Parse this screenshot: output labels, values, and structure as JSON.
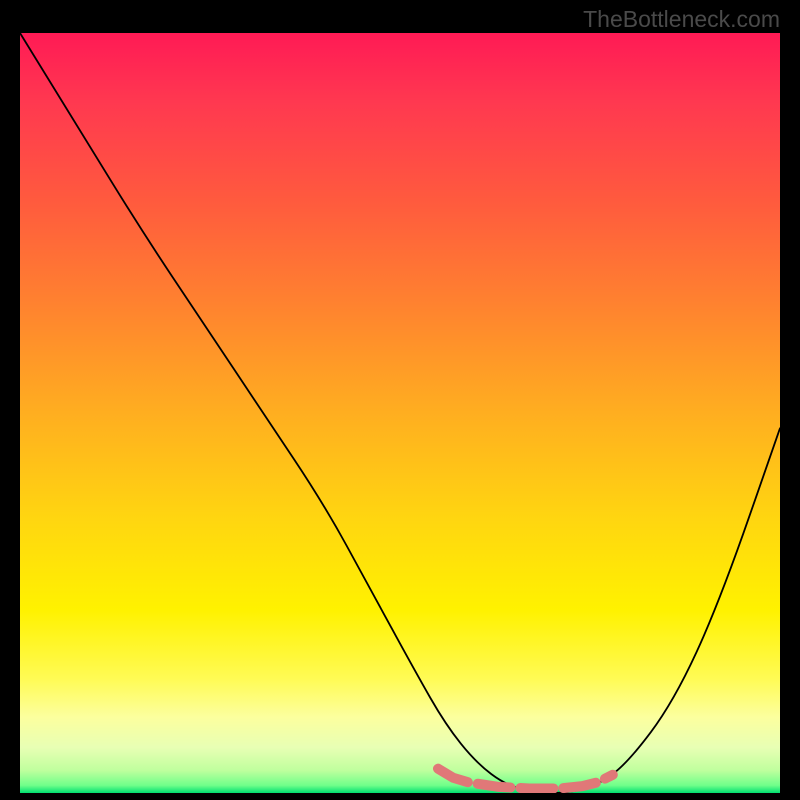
{
  "watermark": "TheBottleneck.com",
  "chart_data": {
    "type": "line",
    "title": "",
    "xlabel": "",
    "ylabel": "",
    "xlim": [
      0,
      100
    ],
    "ylim": [
      0,
      100
    ],
    "series": [
      {
        "name": "curve",
        "x": [
          0,
          8,
          16,
          24,
          32,
          40,
          46,
          52,
          56,
          60,
          64,
          68,
          72,
          76,
          80,
          86,
          92,
          100
        ],
        "y": [
          100,
          87,
          74,
          62,
          50,
          38,
          27,
          16,
          9,
          4,
          1,
          0,
          0,
          1,
          4,
          12,
          25,
          48
        ]
      },
      {
        "name": "segments",
        "x": [
          55,
          57,
          59,
          63,
          67,
          71,
          74,
          76,
          78
        ],
        "y": [
          3.2,
          2.0,
          1.4,
          0.8,
          0.6,
          0.6,
          0.9,
          1.4,
          2.4
        ]
      }
    ],
    "colors": {
      "curve_stroke": "#000000",
      "segments_stroke": "#e07878"
    }
  }
}
